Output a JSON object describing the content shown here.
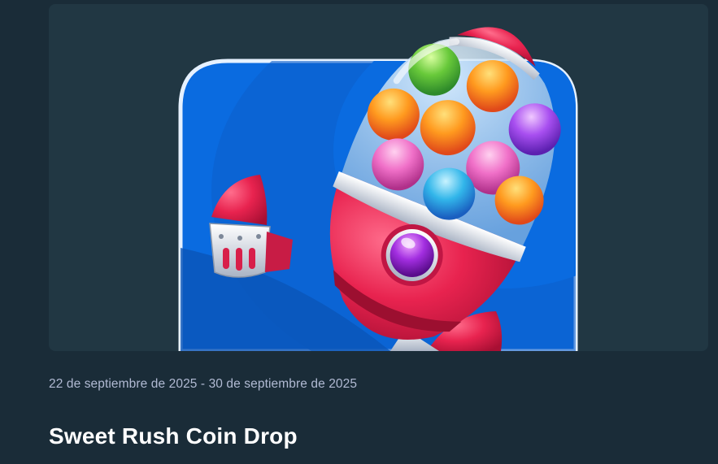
{
  "promotion": {
    "date_range": "22 de septiembre de 2025 - 30 de septiembre de 2025",
    "title": "Sweet Rush Coin Drop",
    "image_subject": "gumball-rocket-icon"
  },
  "colors": {
    "page_background": "#1a2c38",
    "card_background": "#213743",
    "tile_blue": "#0a6be0",
    "rocket_red": "#e8234f",
    "text_primary": "#ffffff",
    "text_secondary": "#b1bad3"
  }
}
